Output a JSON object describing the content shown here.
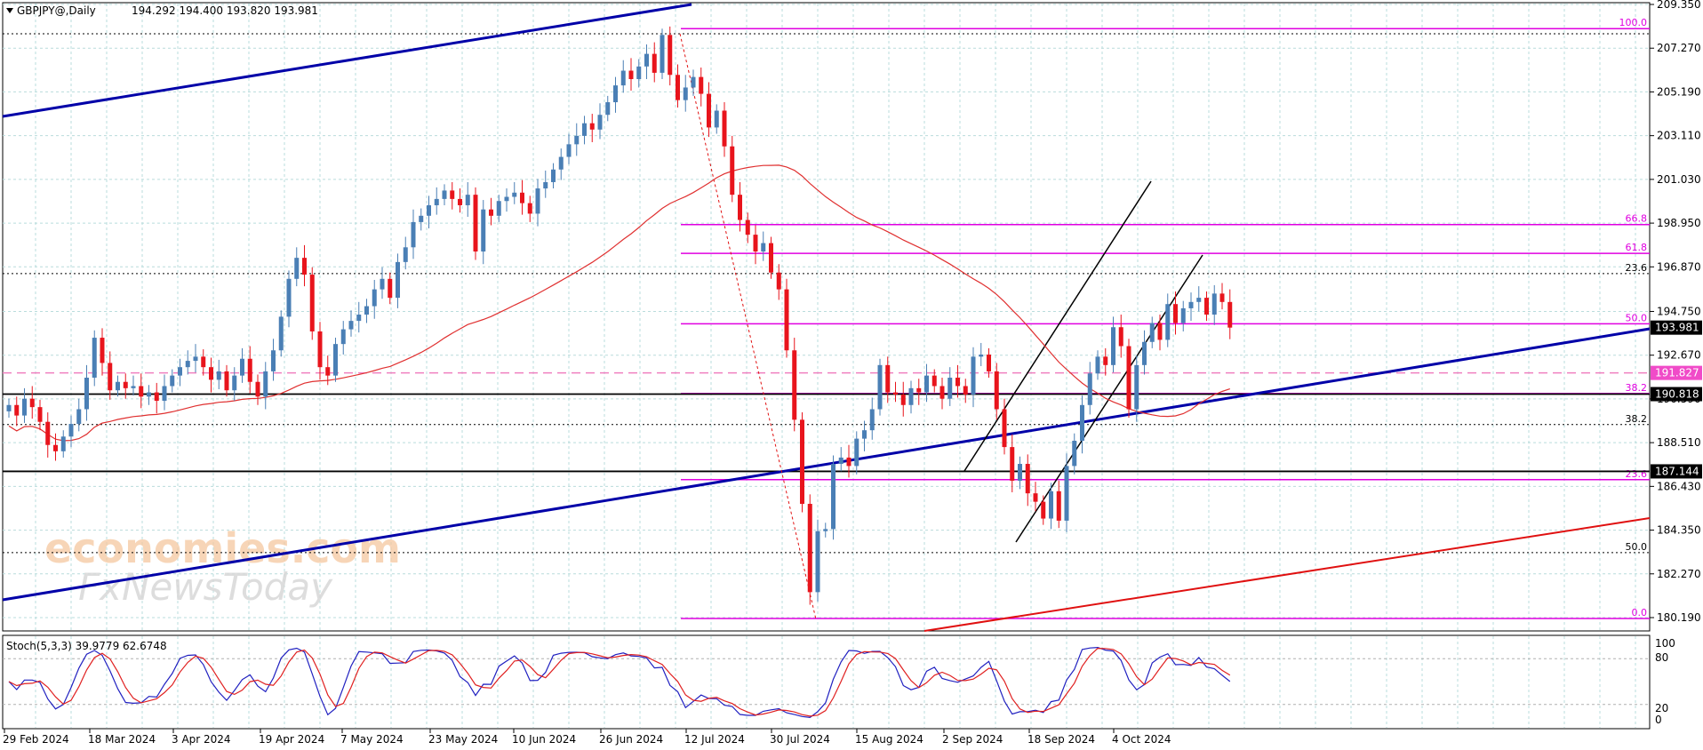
{
  "header": {
    "symbol": "GBPJPY@,Daily",
    "ohlc": "194.292 194.400 193.820 193.981"
  },
  "stoch": {
    "label": "Stoch(5,3,3) 39.9779 62.6748",
    "levels": [
      "100",
      "80",
      "20",
      "0"
    ]
  },
  "watermark": {
    "line1": "economies.com",
    "line2": "FxNewsToday"
  },
  "colors": {
    "bull": "#4a7fb5",
    "bear": "#e8141c",
    "grid": "#b9dcdc",
    "fib": "#e000e0",
    "trend": "#0000a8",
    "ma": "#e03030",
    "stoch_main": "#2020c0",
    "stoch_signal": "#e02020"
  },
  "chart_data": {
    "type": "candlestick",
    "y_ticks": [
      "209.350",
      "207.270",
      "205.190",
      "203.110",
      "201.030",
      "198.950",
      "196.870",
      "194.750",
      "192.670",
      "190.590",
      "188.510",
      "186.430",
      "184.350",
      "182.270",
      "180.190"
    ],
    "ylim": [
      180.19,
      209.35
    ],
    "x_ticks": [
      "29 Feb 2024",
      "18 Mar 2024",
      "3 Apr 2024",
      "19 Apr 2024",
      "7 May 2024",
      "23 May 2024",
      "10 Jun 2024",
      "26 Jun 2024",
      "12 Jul 2024",
      "30 Jul 2024",
      "15 Aug 2024",
      "2 Sep 2024",
      "18 Sep 2024",
      "4 Oct 2024"
    ],
    "price_labels": [
      {
        "label": "193.981",
        "value": 193.981,
        "style": "current"
      },
      {
        "label": "191.827",
        "value": 191.827,
        "style": "pink"
      },
      {
        "label": "190.818",
        "value": 190.818,
        "style": "black"
      },
      {
        "label": "187.144",
        "value": 187.144,
        "style": "black"
      }
    ],
    "fib_levels": [
      {
        "label": "100.0",
        "value": 208.2
      },
      {
        "label": "66.8",
        "value": 198.88
      },
      {
        "label": "61.8",
        "value": 197.51
      },
      {
        "label": "50.0",
        "value": 194.16
      },
      {
        "label": "38.2",
        "value": 190.85
      },
      {
        "label": "23.6",
        "value": 186.75
      },
      {
        "label": "0.0",
        "value": 180.15
      }
    ],
    "dotted_levels": [
      {
        "label": "23.6",
        "value": 196.55
      },
      {
        "label": "38.2",
        "value": 189.37
      },
      {
        "label": "50.0",
        "value": 183.28
      }
    ],
    "closes": [
      190.3,
      189.8,
      190.6,
      190.2,
      189.5,
      188.4,
      188.1,
      188.8,
      189.4,
      190.1,
      191.6,
      193.5,
      192.3,
      191.0,
      191.4,
      191.1,
      191.2,
      190.7,
      190.9,
      190.5,
      191.2,
      191.7,
      192.1,
      192.4,
      192.6,
      192.1,
      191.5,
      191.9,
      191.0,
      191.7,
      192.5,
      191.4,
      190.7,
      191.9,
      192.9,
      194.5,
      196.3,
      197.3,
      196.5,
      193.8,
      192.1,
      191.7,
      193.2,
      193.9,
      194.3,
      194.6,
      195.0,
      195.8,
      196.3,
      195.4,
      197.1,
      197.8,
      199.0,
      199.3,
      199.8,
      200.1,
      200.5,
      200.1,
      199.8,
      200.3,
      197.6,
      199.6,
      199.3,
      200.0,
      200.2,
      200.4,
      199.9,
      199.4,
      200.6,
      200.9,
      201.5,
      202.1,
      202.7,
      203.1,
      203.7,
      203.4,
      204.1,
      204.7,
      205.5,
      206.2,
      205.8,
      206.4,
      207.0,
      206.1,
      207.9,
      206.0,
      204.8,
      205.4,
      205.9,
      205.1,
      203.5,
      204.3,
      202.6,
      200.3,
      199.1,
      198.4,
      197.6,
      198.0,
      196.6,
      195.8,
      192.9,
      189.6,
      185.6,
      181.4,
      184.3,
      184.4,
      187.5,
      187.8,
      187.4,
      188.7,
      189.1,
      190.1,
      192.2,
      190.9,
      190.8,
      190.3,
      191.1,
      190.9,
      191.7,
      191.2,
      190.6,
      191.6,
      191.2,
      190.8,
      192.6,
      192.7,
      191.9,
      190.1,
      188.3,
      186.7,
      187.5,
      186.1,
      185.7,
      184.9,
      186.2,
      184.8,
      187.4,
      188.6,
      190.3,
      191.8,
      192.6,
      192.2,
      194.0,
      193.1,
      190.1,
      192.2,
      193.3,
      194.2,
      193.4,
      195.1,
      194.2,
      194.9,
      195.2,
      195.4,
      194.6,
      195.6,
      195.2,
      193.981
    ]
  }
}
